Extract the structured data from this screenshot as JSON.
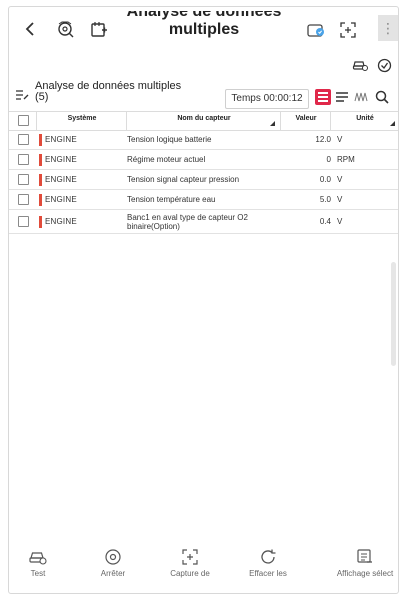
{
  "header": {
    "title_line1": "Analyse de données",
    "title_line2": "multiples",
    "icons": [
      "back-icon",
      "vehicle-search-icon",
      "document-add-icon",
      "vci-connect-icon",
      "screen-capture-icon",
      "more-menu-icon"
    ],
    "menu_glyph": "⋮"
  },
  "toolbar": {
    "title": "Analyse de données multiples",
    "count": "(5)",
    "time_label": "Temps 00:00:12",
    "icons": [
      "edit-list-icon",
      "list-view-icon",
      "text-view-icon",
      "graph-view-icon",
      "search-icon",
      "car-settings-icon",
      "record-icon"
    ]
  },
  "table": {
    "headers": {
      "system": "Système",
      "sensor": "Nom du capteur",
      "value": "Valeur",
      "unit": "Unité"
    },
    "rows": [
      {
        "system": "ENGINE",
        "sensor": "Tension logique batterie",
        "value": "12.0",
        "unit": "V"
      },
      {
        "system": "ENGINE",
        "sensor": "Régime moteur actuel",
        "value": "0",
        "unit": "RPM"
      },
      {
        "system": "ENGINE",
        "sensor": "Tension signal capteur pression",
        "value": "0.0",
        "unit": "V"
      },
      {
        "system": "ENGINE",
        "sensor": "Tension température eau",
        "value": "5.0",
        "unit": "V"
      },
      {
        "system": "ENGINE",
        "sensor": "Banc1 en aval type de capteur O2 binaire(Option)",
        "value": "0.4",
        "unit": "V"
      }
    ]
  },
  "bottom": {
    "buttons": [
      {
        "label": "Test",
        "icon": "car-test-icon"
      },
      {
        "label": "Arrêter",
        "icon": "stop-icon"
      },
      {
        "label": "Capture de",
        "icon": "capture-icon"
      },
      {
        "label": "Effacer les",
        "icon": "refresh-clear-icon"
      },
      {
        "label": "Affichage sélect",
        "icon": "display-select-icon"
      }
    ]
  },
  "colors": {
    "accent": "#e0284a",
    "system_marker": "#e14b3a"
  }
}
